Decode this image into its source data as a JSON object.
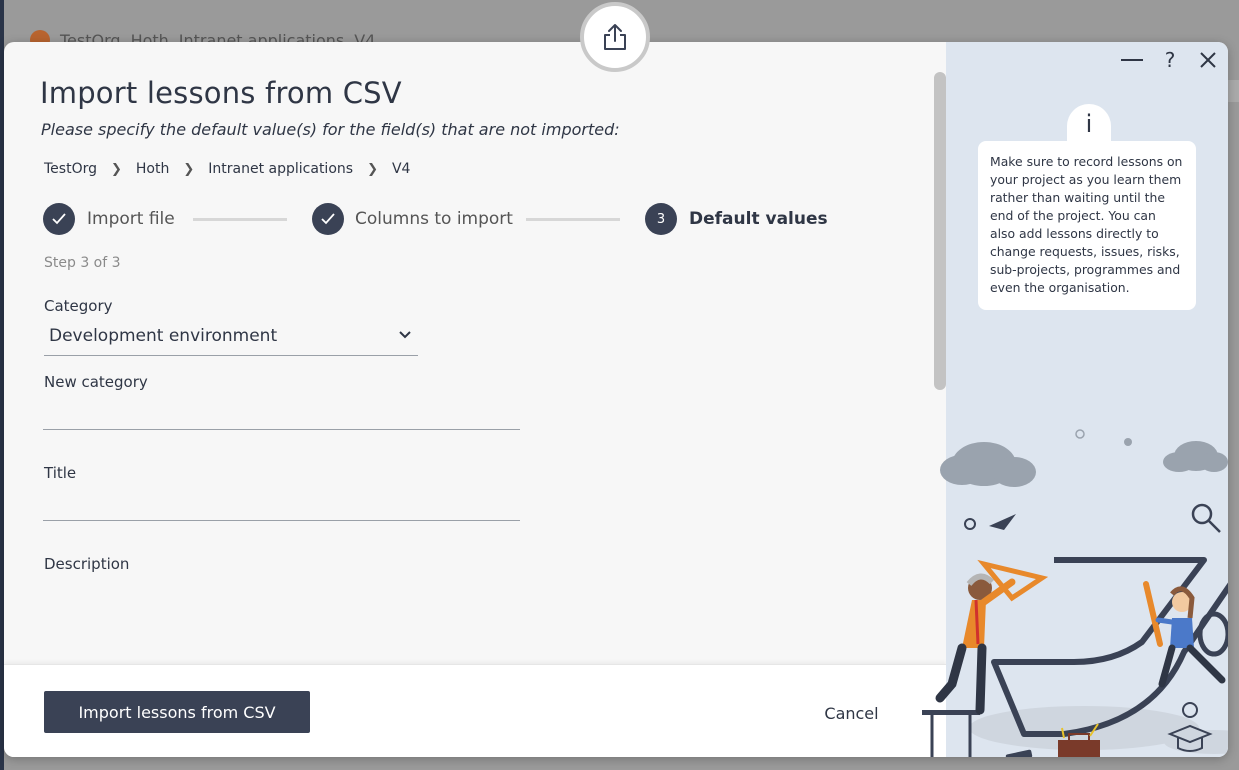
{
  "background": {
    "breadcrumb": [
      "TestOrg",
      "Hoth",
      "Intranet applications",
      "V4"
    ]
  },
  "modal": {
    "title": "Import lessons from CSV",
    "subtitle": "Please specify the default value(s) for the field(s) that are not imported:",
    "breadcrumb": [
      "TestOrg",
      "Hoth",
      "Intranet applications",
      "V4"
    ],
    "steps": [
      {
        "label": "Import file",
        "state": "done"
      },
      {
        "label": "Columns to import",
        "state": "done"
      },
      {
        "label": "Default values",
        "state": "active",
        "number": "3"
      }
    ],
    "step_count": "Step 3 of 3",
    "fields": {
      "category_label": "Category",
      "category_value": "Development environment",
      "new_category_label": "New category",
      "new_category_value": "",
      "title_label": "Title",
      "title_value": "",
      "description_label": "Description"
    },
    "primary_button": "Import lessons from CSV",
    "cancel_button": "Cancel",
    "window_controls": {
      "minimize": "—",
      "help": "?",
      "close": "✕"
    }
  },
  "help_panel": {
    "info_glyph": "i",
    "tip": "Make sure to record lessons on your project as you learn them rather than waiting until the end of the project. You can also add lessons directly to change requests, issues, risks, sub-projects, programmes and even the organisation."
  },
  "colors": {
    "primary": "#3a4255",
    "panel_bg": "#dde5ef",
    "modal_bg": "#f7f7f7",
    "accent_orange": "#e8892b"
  }
}
